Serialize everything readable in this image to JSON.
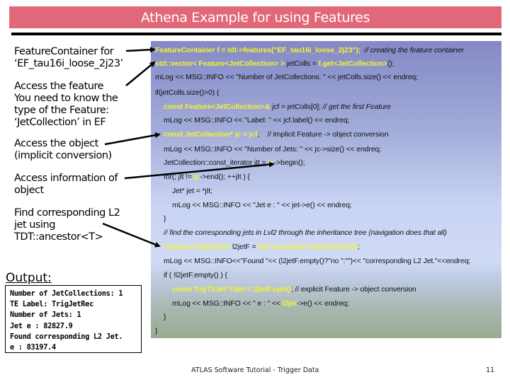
{
  "slide": {
    "title": "Athena Example for using Features",
    "footer": "ATLAS Software Tutorial - Trigger Data",
    "page_number": "11",
    "colors": {
      "title_bar": "#e06878",
      "code_highlight": "#f4f42a",
      "code_box_top": "#8489c6",
      "code_box_bottom": "#98ab90"
    }
  },
  "annotations": [
    {
      "text": "FeatureContainer for\n‘EF_tau16i_loose_2j23’"
    },
    {
      "text": "Access the feature\nYou need to know the\ntype of the Feature:\n‘JetCollection’ in EF"
    },
    {
      "text": "Access the object\n(implicit conversion)"
    },
    {
      "text": "Access information of\nobject"
    },
    {
      "text": "Find corresponding L2\njet using\nTDT::ancestor<T>"
    }
  ],
  "output": {
    "label": "Output:",
    "lines": [
      "Number of JetCollections: 1",
      "TE Label: TrigJetRec",
      "Number of Jets: 1",
      "Jet e : 82827.9",
      "Found corresponding L2 Jet.",
      "e : 83197.4"
    ]
  },
  "code": {
    "lines": [
      {
        "indent": 0,
        "parts": [
          {
            "t": "FeatureContainer f = tdt->features(",
            "s": "hl"
          },
          {
            "t": "\"EF_tau16i_loose_2j23\"); ",
            "s": "hlq"
          },
          {
            "t": " // creating the feature container",
            "s": "cm"
          }
        ]
      },
      {
        "indent": 0,
        "parts": [
          {
            "t": "std::vector< Feature<JetCollection> >",
            "s": "hl"
          },
          {
            "t": " jetColls = ",
            "s": ""
          },
          {
            "t": "f.get<JetCollection>",
            "s": "hl"
          },
          {
            "t": "();",
            "s": ""
          }
        ]
      },
      {
        "indent": 0,
        "parts": [
          {
            "t": "mLog << MSG::INFO << \"Number of JetCollections: \" << jetColls.size() << endreq;",
            "s": ""
          }
        ]
      },
      {
        "indent": 0,
        "parts": [
          {
            "t": "if(jetColls.size()>0) {",
            "s": ""
          }
        ]
      },
      {
        "indent": 1,
        "parts": [
          {
            "t": "const Feature<JetCollection>&",
            "s": "hl"
          },
          {
            "t": " jcf = jetColls[0]; ",
            "s": ""
          },
          {
            "t": "// get the first Feature",
            "s": "cm"
          }
        ]
      },
      {
        "indent": 1,
        "parts": [
          {
            "t": "mLog << MSG::INFO << \"Label: \" << jcf.label() << endreq;",
            "s": ""
          }
        ]
      },
      {
        "indent": 1,
        "parts": [
          {
            "t": "const JetCollection* jc = jcf",
            "s": "hl"
          },
          {
            "t": ";    // implicit Feature -> object conversion",
            "s": ""
          }
        ]
      },
      {
        "indent": 1,
        "parts": [
          {
            "t": "mLog << MSG::INFO << \"Number of Jets: \" << jc->size() << endreq;",
            "s": ""
          }
        ]
      },
      {
        "indent": 1,
        "parts": [
          {
            "t": "JetCollection::const_iterator jIt = ",
            "s": ""
          },
          {
            "t": "jc",
            "s": "hl"
          },
          {
            "t": "->begin();",
            "s": ""
          }
        ]
      },
      {
        "indent": 1,
        "parts": [
          {
            "t": "for(; jIt != ",
            "s": ""
          },
          {
            "t": "jc",
            "s": "hl"
          },
          {
            "t": "->end(); ++jIt ) {",
            "s": ""
          }
        ]
      },
      {
        "indent": 2,
        "parts": [
          {
            "t": "Jet* jet = *jIt;",
            "s": ""
          }
        ]
      },
      {
        "indent": 2,
        "parts": [
          {
            "t": "mLog << MSG::INFO << \"Jet e : \" << jet->e() << endreq;",
            "s": ""
          }
        ]
      },
      {
        "indent": 1,
        "parts": [
          {
            "t": "}",
            "s": ""
          }
        ]
      },
      {
        "indent": 1,
        "parts": [
          {
            "t": "// find the corresponding jets in Lvl2 through the inheritance tree (navigation does that all)",
            "s": "cm"
          }
        ]
      },
      {
        "indent": 1,
        "parts": [
          {
            "t": "Feature<TrigT2Jet>",
            "s": "hl"
          },
          {
            "t": " l2jetF = ",
            "s": ""
          },
          {
            "t": "tdt->ancestor<TrigT2Jet>(jcf)",
            "s": "hl"
          },
          {
            "t": ";",
            "s": ""
          }
        ]
      },
      {
        "indent": 1,
        "parts": [
          {
            "t": "mLog << MSG::INFO<<\"Found \"<< (l2jetF.empty()?\"no \":\"\")<< \"corresponding L2 Jet.\"<<endreq;",
            "s": ""
          }
        ]
      },
      {
        "indent": 1,
        "parts": [
          {
            "t": "if ( !l2jetF.empty() ) {",
            "s": ""
          }
        ]
      },
      {
        "indent": 2,
        "parts": [
          {
            "t": "const TrigT2Jet* l2jet = l2jetF.cptr()",
            "s": "hl"
          },
          {
            "t": "; // explicit Feature -> object conversion",
            "s": ""
          }
        ]
      },
      {
        "indent": 2,
        "parts": [
          {
            "t": "mLog << MSG::INFO << \" e : \" << ",
            "s": ""
          },
          {
            "t": "l2jet",
            "s": "hl"
          },
          {
            "t": "->e() << endreq;",
            "s": ""
          }
        ]
      },
      {
        "indent": 1,
        "parts": [
          {
            "t": "}",
            "s": ""
          }
        ]
      },
      {
        "indent": 0,
        "parts": [
          {
            "t": "}",
            "s": ""
          }
        ]
      }
    ]
  }
}
